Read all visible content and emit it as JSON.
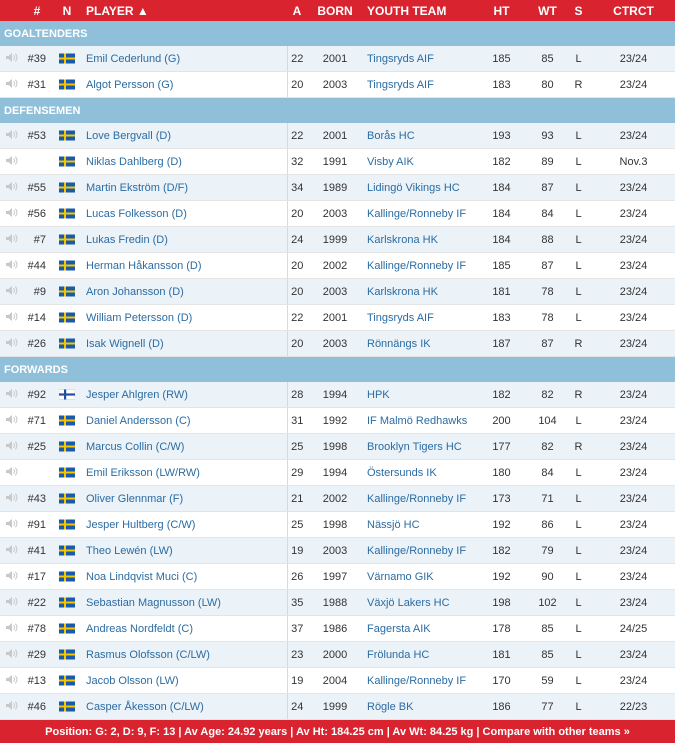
{
  "headers": {
    "num": "#",
    "nat": "N",
    "player": "PLAYER ▲",
    "age": "A",
    "born": "BORN",
    "youth": "YOUTH TEAM",
    "ht": "HT",
    "wt": "WT",
    "s": "S",
    "ctrct": "CTRCT"
  },
  "sections": [
    {
      "title": "GOALTENDERS",
      "players": [
        {
          "num": "#39",
          "flag": "SE",
          "name": "Emil Cederlund (G)",
          "age": "22",
          "born": "2001",
          "team": "Tingsryds AIF",
          "ht": "185",
          "wt": "85",
          "s": "L",
          "ctrct": "23/24"
        },
        {
          "num": "#31",
          "flag": "SE",
          "name": "Algot Persson (G)",
          "age": "20",
          "born": "2003",
          "team": "Tingsryds AIF",
          "ht": "183",
          "wt": "80",
          "s": "R",
          "ctrct": "23/24"
        }
      ]
    },
    {
      "title": "DEFENSEMEN",
      "players": [
        {
          "num": "#53",
          "flag": "SE",
          "name": "Love Bergvall (D)",
          "age": "22",
          "born": "2001",
          "team": "Borås HC",
          "ht": "193",
          "wt": "93",
          "s": "L",
          "ctrct": "23/24"
        },
        {
          "num": "",
          "flag": "SE",
          "name": "Niklas Dahlberg (D)",
          "age": "32",
          "born": "1991",
          "team": "Visby AIK",
          "ht": "182",
          "wt": "89",
          "s": "L",
          "ctrct": "Nov.3"
        },
        {
          "num": "#55",
          "flag": "SE",
          "name": "Martin Ekström (D/F)",
          "age": "34",
          "born": "1989",
          "team": "Lidingö Vikings HC",
          "ht": "184",
          "wt": "87",
          "s": "L",
          "ctrct": "23/24"
        },
        {
          "num": "#56",
          "flag": "SE",
          "name": "Lucas Folkesson (D)",
          "age": "20",
          "born": "2003",
          "team": "Kallinge/Ronneby IF",
          "ht": "184",
          "wt": "84",
          "s": "L",
          "ctrct": "23/24"
        },
        {
          "num": "#7",
          "flag": "SE",
          "name": "Lukas Fredin (D)",
          "age": "24",
          "born": "1999",
          "team": "Karlskrona HK",
          "ht": "184",
          "wt": "88",
          "s": "L",
          "ctrct": "23/24"
        },
        {
          "num": "#44",
          "flag": "SE",
          "name": "Herman Håkansson (D)",
          "age": "20",
          "born": "2002",
          "team": "Kallinge/Ronneby IF",
          "ht": "185",
          "wt": "87",
          "s": "L",
          "ctrct": "23/24"
        },
        {
          "num": "#9",
          "flag": "SE",
          "name": "Aron Johansson (D)",
          "age": "20",
          "born": "2003",
          "team": "Karlskrona HK",
          "ht": "181",
          "wt": "78",
          "s": "L",
          "ctrct": "23/24"
        },
        {
          "num": "#14",
          "flag": "SE",
          "name": "William Petersson (D)",
          "age": "22",
          "born": "2001",
          "team": "Tingsryds AIF",
          "ht": "183",
          "wt": "78",
          "s": "L",
          "ctrct": "23/24"
        },
        {
          "num": "#26",
          "flag": "SE",
          "name": "Isak Wignell (D)",
          "age": "20",
          "born": "2003",
          "team": "Rönnängs IK",
          "ht": "187",
          "wt": "87",
          "s": "R",
          "ctrct": "23/24"
        }
      ]
    },
    {
      "title": "FORWARDS",
      "players": [
        {
          "num": "#92",
          "flag": "FI",
          "name": "Jesper Ahlgren (RW)",
          "age": "28",
          "born": "1994",
          "team": "HPK",
          "ht": "182",
          "wt": "82",
          "s": "R",
          "ctrct": "23/24"
        },
        {
          "num": "#71",
          "flag": "SE",
          "name": "Daniel Andersson (C)",
          "age": "31",
          "born": "1992",
          "team": "IF Malmö Redhawks",
          "ht": "200",
          "wt": "104",
          "s": "L",
          "ctrct": "23/24"
        },
        {
          "num": "#25",
          "flag": "SE",
          "name": "Marcus Collin (C/W)",
          "age": "25",
          "born": "1998",
          "team": "Brooklyn Tigers HC",
          "ht": "177",
          "wt": "82",
          "s": "R",
          "ctrct": "23/24"
        },
        {
          "num": "",
          "flag": "SE",
          "name": "Emil Eriksson (LW/RW)",
          "age": "29",
          "born": "1994",
          "team": "Östersunds IK",
          "ht": "180",
          "wt": "84",
          "s": "L",
          "ctrct": "23/24"
        },
        {
          "num": "#43",
          "flag": "SE",
          "name": "Oliver Glennmar (F)",
          "age": "21",
          "born": "2002",
          "team": "Kallinge/Ronneby IF",
          "ht": "173",
          "wt": "71",
          "s": "L",
          "ctrct": "23/24"
        },
        {
          "num": "#91",
          "flag": "SE",
          "name": "Jesper Hultberg (C/W)",
          "age": "25",
          "born": "1998",
          "team": "Nässjö HC",
          "ht": "192",
          "wt": "86",
          "s": "L",
          "ctrct": "23/24"
        },
        {
          "num": "#41",
          "flag": "SE",
          "name": "Theo Lewén (LW)",
          "age": "19",
          "born": "2003",
          "team": "Kallinge/Ronneby IF",
          "ht": "182",
          "wt": "79",
          "s": "L",
          "ctrct": "23/24"
        },
        {
          "num": "#17",
          "flag": "SE",
          "name": "Noa Lindqvist Muci (C)",
          "age": "26",
          "born": "1997",
          "team": "Värnamo GIK",
          "ht": "192",
          "wt": "90",
          "s": "L",
          "ctrct": "23/24"
        },
        {
          "num": "#22",
          "flag": "SE",
          "name": "Sebastian Magnusson (LW)",
          "age": "35",
          "born": "1988",
          "team": "Växjö Lakers HC",
          "ht": "198",
          "wt": "102",
          "s": "L",
          "ctrct": "23/24"
        },
        {
          "num": "#78",
          "flag": "SE",
          "name": "Andreas Nordfeldt (C)",
          "age": "37",
          "born": "1986",
          "team": "Fagersta AIK",
          "ht": "178",
          "wt": "85",
          "s": "L",
          "ctrct": "24/25"
        },
        {
          "num": "#29",
          "flag": "SE",
          "name": "Rasmus Olofsson (C/LW)",
          "age": "23",
          "born": "2000",
          "team": "Frölunda HC",
          "ht": "181",
          "wt": "85",
          "s": "L",
          "ctrct": "23/24"
        },
        {
          "num": "#13",
          "flag": "SE",
          "name": "Jacob Olsson (LW)",
          "age": "19",
          "born": "2004",
          "team": "Kallinge/Ronneby IF",
          "ht": "170",
          "wt": "59",
          "s": "L",
          "ctrct": "23/24"
        },
        {
          "num": "#46",
          "flag": "SE",
          "name": "Casper Åkesson (C/LW)",
          "age": "24",
          "born": "1999",
          "team": "Rögle BK",
          "ht": "186",
          "wt": "77",
          "s": "L",
          "ctrct": "22/23"
        }
      ]
    }
  ],
  "footer": {
    "text": "Position: G: 2, D: 9, F: 13 | Av Age: 24.92 years | Av Ht: 184.25 cm | Av Wt: 84.25 kg |",
    "link": "Compare with other teams »"
  },
  "colors": {
    "header": "#d9232f",
    "section": "#8fbfd9",
    "stripe": "#ebf2f8",
    "link": "#2b6ca3"
  },
  "icons": {
    "audio": "speaker-icon",
    "flags": {
      "SE": "sweden-flag-icon",
      "FI": "finland-flag-icon"
    }
  }
}
